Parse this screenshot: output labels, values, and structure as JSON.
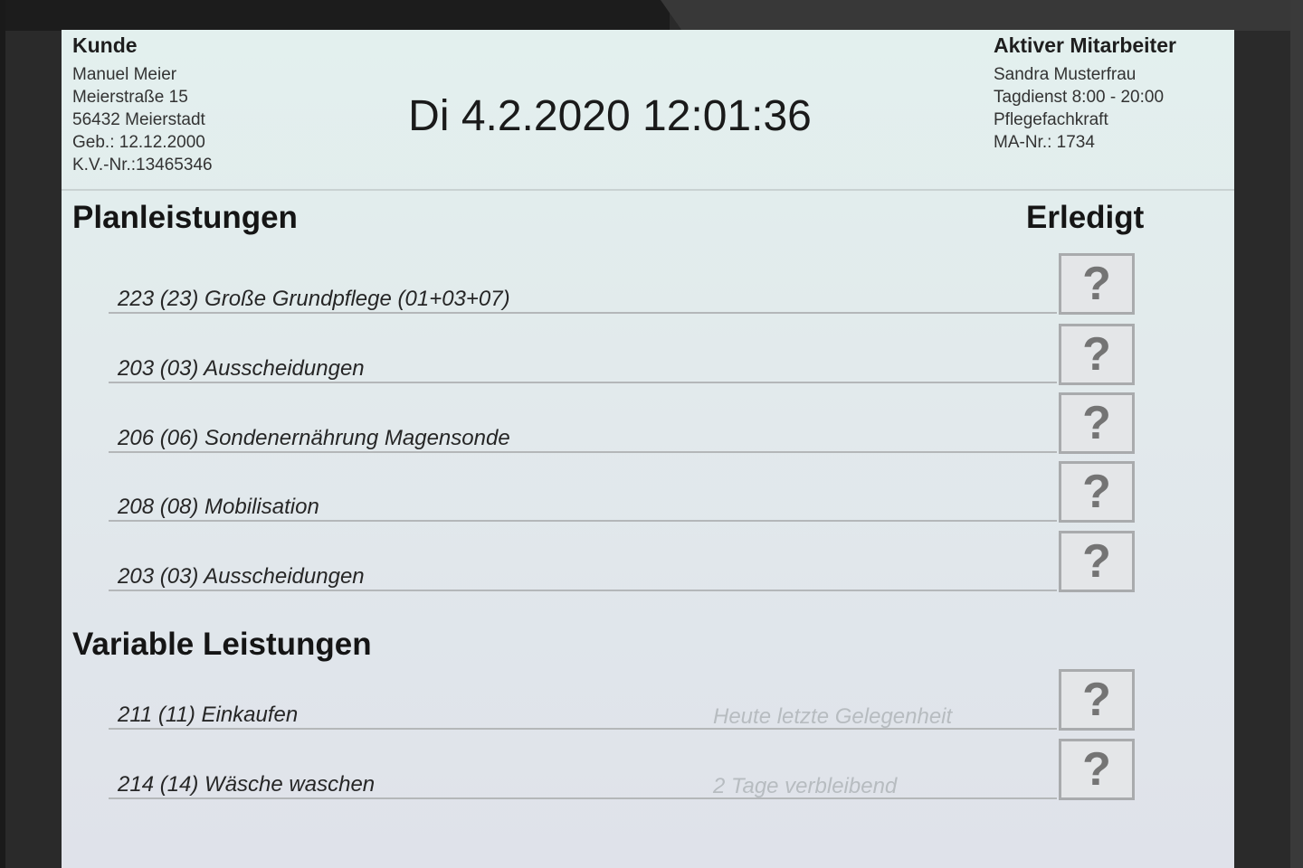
{
  "customer": {
    "heading": "Kunde",
    "name": "Manuel Meier",
    "street": "Meierstraße 15",
    "city": "56432 Meierstadt",
    "birth": "Geb.: 12.12.2000",
    "insurance": "K.V.-Nr.:13465346"
  },
  "datetime": "Di 4.2.2020 12:01:36",
  "employee": {
    "heading": "Aktiver Mitarbeiter",
    "name": "Sandra Musterfrau",
    "shift": "Tagdienst 8:00 - 20:00",
    "role": "Pflegefachkraft",
    "number": "MA-Nr.: 1734"
  },
  "planned": {
    "heading": "Planleistungen",
    "done_heading": "Erledigt",
    "items": [
      {
        "label": "223 (23) Große Grundpflege (01+03+07)",
        "status": "?"
      },
      {
        "label": "203 (03) Ausscheidungen",
        "status": "?"
      },
      {
        "label": "206 (06) Sondenernährung Magensonde",
        "status": "?"
      },
      {
        "label": "208 (08) Mobilisation",
        "status": "?"
      },
      {
        "label": "203 (03) Ausscheidungen",
        "status": "?"
      }
    ]
  },
  "variable": {
    "heading": "Variable Leistungen",
    "items": [
      {
        "label": "211 (11) Einkaufen",
        "hint": "Heute letzte Gelegenheit",
        "status": "?"
      },
      {
        "label": "214 (14) Wäsche waschen",
        "hint": "2 Tage verbleibend",
        "status": "?"
      }
    ]
  },
  "colors": {
    "screen_top": "#e3f0ee",
    "screen_bottom": "#dfe2ea",
    "hint_text": "#b7bcc0",
    "status_icon": "#747474"
  }
}
